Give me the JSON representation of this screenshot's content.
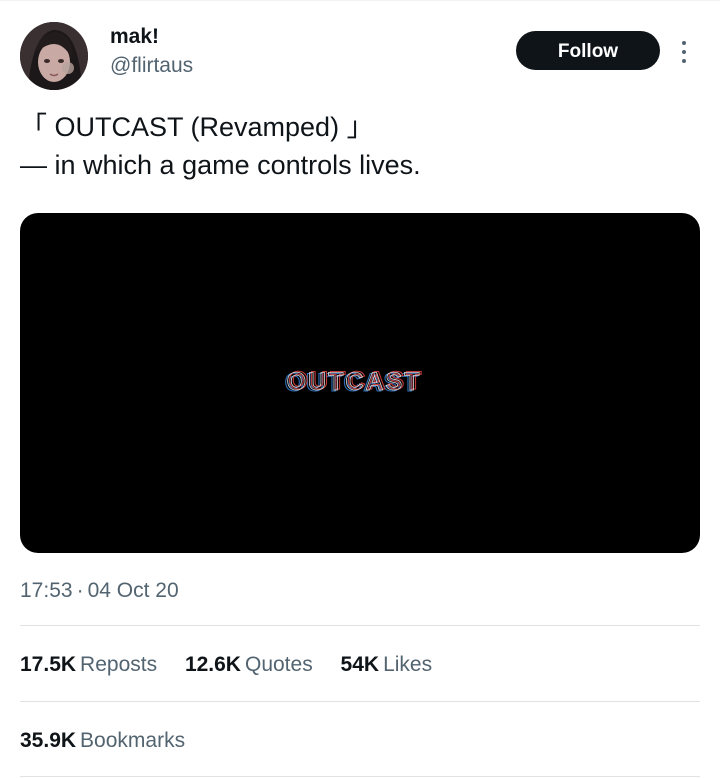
{
  "author": {
    "display_name": "mak!",
    "handle": "@flirtaus"
  },
  "actions": {
    "follow_label": "Follow"
  },
  "tweet": {
    "line1": "「 OUTCAST (Revamped) 」",
    "line2": "— in which a game controls lives."
  },
  "media": {
    "title_text": "OUTCAST"
  },
  "meta": {
    "time": "17:53",
    "separator": "·",
    "date": "04 Oct 20"
  },
  "stats": {
    "reposts_count": "17.5K",
    "reposts_label": "Reposts",
    "quotes_count": "12.6K",
    "quotes_label": "Quotes",
    "likes_count": "54K",
    "likes_label": "Likes",
    "bookmarks_count": "35.9K",
    "bookmarks_label": "Bookmarks"
  },
  "icons": {
    "more": "more-horizontal-dots-icon"
  },
  "colors": {
    "text_primary": "#0f1419",
    "text_secondary": "#536471",
    "follow_bg": "#0f1419",
    "divider": "#dfe3e6",
    "media_bg": "#000000"
  }
}
